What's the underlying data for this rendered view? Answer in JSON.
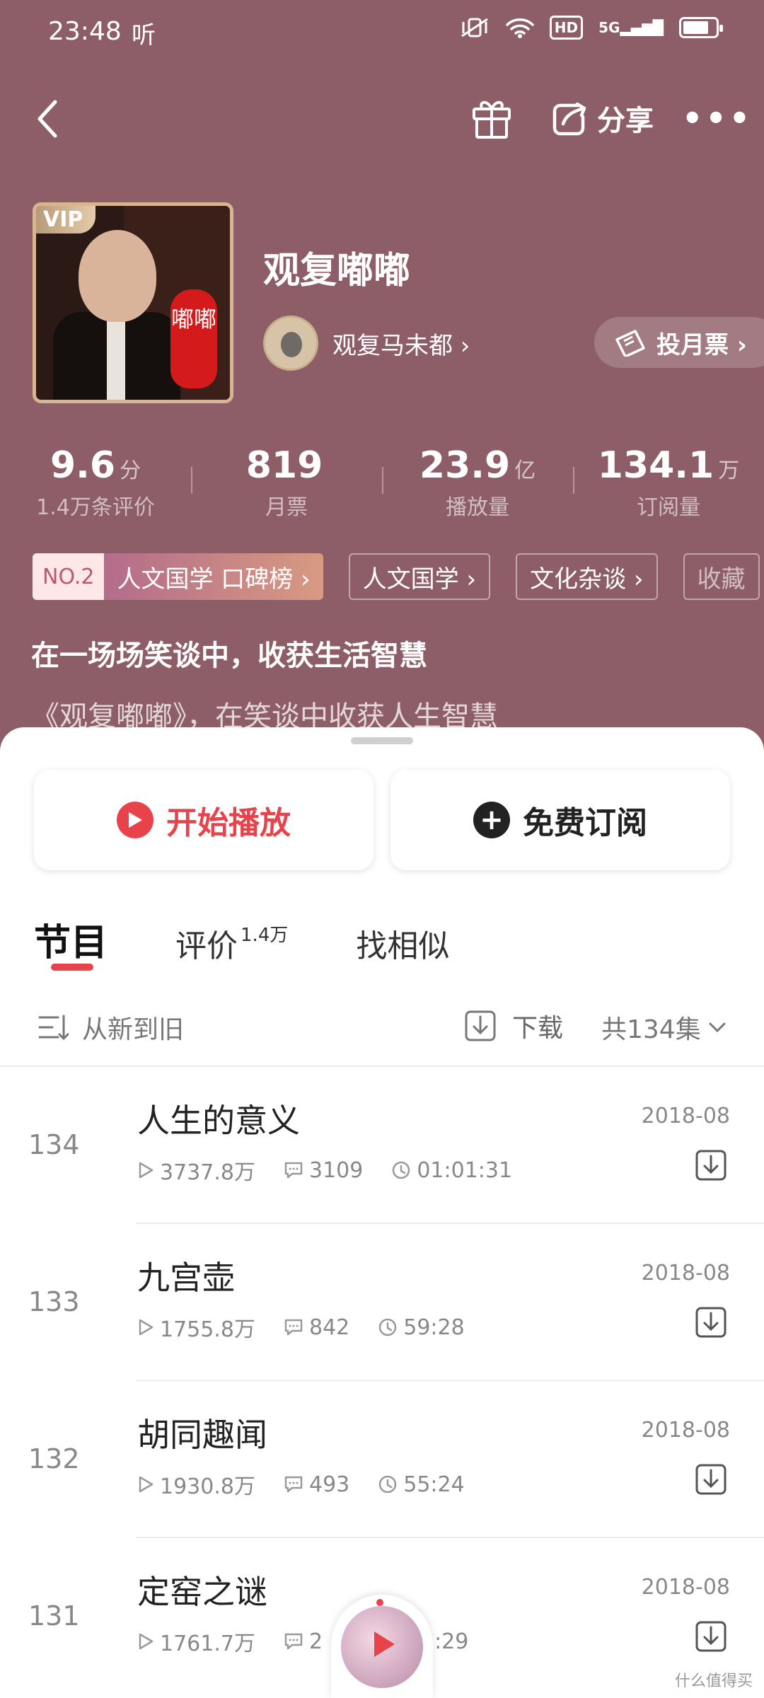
{
  "status": {
    "time": "23:48",
    "app_glyph": "听",
    "network": "5G",
    "hd": "HD"
  },
  "nav": {
    "share_label": "分享"
  },
  "podcast": {
    "title": "观复嘟嘟",
    "vip": "VIP",
    "cover_text": "嘟嘟",
    "author": "观复马未都 ›",
    "vote": "投月票 ›"
  },
  "stats": [
    {
      "value": "9.6",
      "unit": "分",
      "label": "1.4万条评价"
    },
    {
      "value": "819",
      "unit": "",
      "label": "月票"
    },
    {
      "value": "23.9",
      "unit": "亿",
      "label": "播放量"
    },
    {
      "value": "134.1",
      "unit": "万",
      "label": "订阅量"
    }
  ],
  "tags": {
    "rank_no": "NO.2",
    "rank_name": "人文国学 口碑榜 ›",
    "items": [
      "人文国学 ›",
      "文化杂谈 ›",
      "收藏"
    ]
  },
  "slogan": "在一场场笑谈中，收获生活智慧",
  "description": "《观复嘟嘟》，在笑谈中收获人生智慧",
  "actions": {
    "play": "开始播放",
    "subscribe": "免费订阅"
  },
  "tabs": [
    {
      "label": "节目",
      "sup": ""
    },
    {
      "label": "评价",
      "sup": "1.4万"
    },
    {
      "label": "找相似",
      "sup": ""
    }
  ],
  "toolbar": {
    "sort": "从新到旧",
    "download": "下载",
    "total": "共134集"
  },
  "episodes": [
    {
      "num": "134",
      "title": "人生的意义",
      "date": "2018-08",
      "plays": "3737.8万",
      "comments": "3109",
      "duration": "01:01:31"
    },
    {
      "num": "133",
      "title": "九宫壶",
      "date": "2018-08",
      "plays": "1755.8万",
      "comments": "842",
      "duration": "59:28"
    },
    {
      "num": "132",
      "title": "胡同趣闻",
      "date": "2018-08",
      "plays": "1930.8万",
      "comments": "493",
      "duration": "55:24"
    },
    {
      "num": "131",
      "title": "定窑之谜",
      "date": "2018-08",
      "plays": "1761.7万",
      "comments": "2",
      "duration": ":29"
    }
  ],
  "watermark": "什么值得买",
  "colors": {
    "hero": "#8e5e68",
    "accent": "#e8424a"
  }
}
